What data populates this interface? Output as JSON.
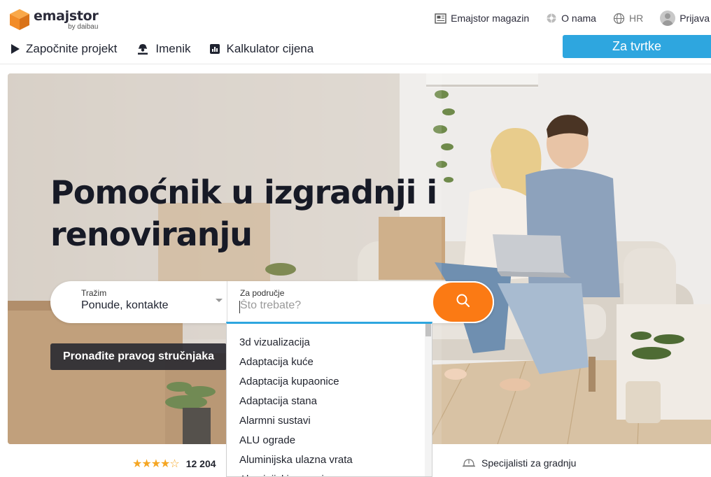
{
  "brand": {
    "name": "emajstor",
    "byline": "by daibau"
  },
  "top_links": {
    "magazine": "Emajstor magazin",
    "about": "O nama",
    "language": "HR",
    "login": "Prijava"
  },
  "main_nav": {
    "start_project": "Započnite projekt",
    "directory": "Imenik",
    "price_calculator": "Kalkulator cijena"
  },
  "business_button": "Za tvrtke",
  "hero": {
    "title": "Pomoćnik u izgradnji i renoviranju"
  },
  "search": {
    "type_label": "Tražim",
    "type_value": "Ponude, kontakte",
    "area_label": "Za područje",
    "area_placeholder": "Što trebate?",
    "area_value": ""
  },
  "dropdown_items": [
    "3d vizualizacija",
    "Adaptacija kuće",
    "Adaptacija kupaonice",
    "Adaptacija stana",
    "Alarmni sustavi",
    "ALU ograde",
    "Aluminijska ulazna vrata",
    "Aluminijski prozori"
  ],
  "find_expert": "Pronađite pravog stručnjaka",
  "rating": {
    "stars": "★★★★☆",
    "count": "12 204"
  },
  "specialists": "Specijalisti za gradnju",
  "colors": {
    "accent_blue": "#2ea6df",
    "search_orange": "#fb7a14",
    "logo_orange": "#f28c28",
    "star_gold": "#f5a623"
  }
}
